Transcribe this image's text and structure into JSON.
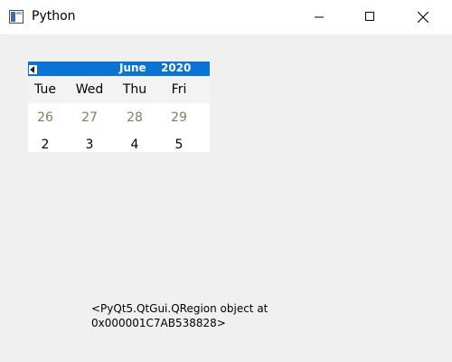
{
  "window": {
    "title": "Python",
    "icon": "python-app-icon"
  },
  "titlebar_controls": {
    "minimize_icon": "minimize-icon",
    "maximize_icon": "maximize-icon",
    "close_icon": "close-icon"
  },
  "calendar": {
    "prev_icon": "prev-month-arrow-icon",
    "month": "June",
    "year": "2020",
    "month_dropdown_icon": "chevron-down-icon",
    "weekdays": [
      "Tue",
      "Wed",
      "Thu",
      "Fri"
    ],
    "rows": [
      [
        "26",
        "27",
        "28",
        "29"
      ],
      [
        "2",
        "3",
        "4",
        "5"
      ]
    ],
    "colors": {
      "nav_bg": "#0a74d6",
      "other_month_text": "#8a7a62"
    }
  },
  "label": {
    "text": "<PyQt5.QtGui.QRegion object at\n0x000001C7AB538828>"
  }
}
